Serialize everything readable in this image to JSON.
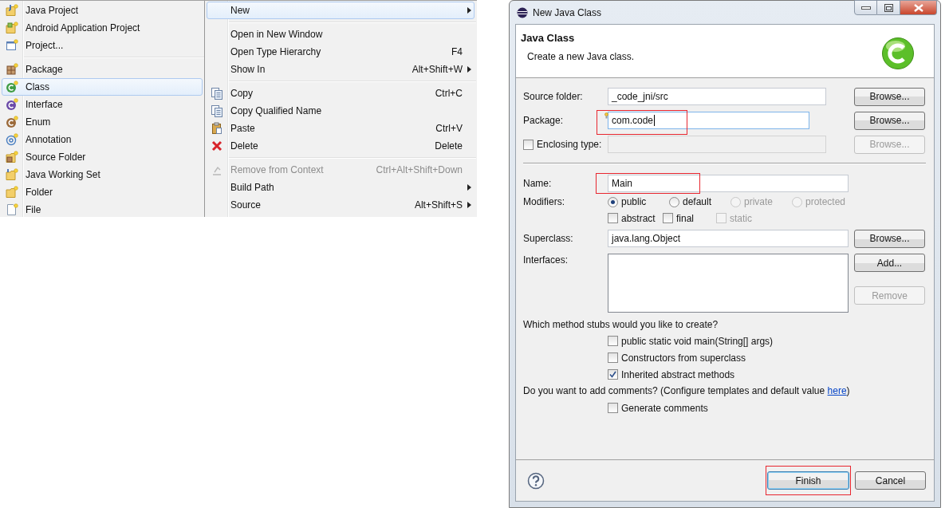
{
  "new_submenu": {
    "groups": [
      [
        {
          "label": "Java Project",
          "kind": "java-project",
          "selected": false
        },
        {
          "label": "Android Application Project",
          "kind": "android-project",
          "selected": false
        },
        {
          "label": "Project...",
          "kind": "project",
          "selected": false
        }
      ],
      [
        {
          "label": "Package",
          "kind": "package",
          "selected": false
        },
        {
          "label": "Class",
          "kind": "class",
          "selected": true
        },
        {
          "label": "Interface",
          "kind": "interface",
          "selected": false
        },
        {
          "label": "Enum",
          "kind": "enum",
          "selected": false
        },
        {
          "label": "Annotation",
          "kind": "annotation",
          "selected": false
        },
        {
          "label": "Source Folder",
          "kind": "source-folder",
          "selected": false
        },
        {
          "label": "Java Working Set",
          "kind": "working-set",
          "selected": false
        },
        {
          "label": "Folder",
          "kind": "folder",
          "selected": false
        },
        {
          "label": "File",
          "kind": "file",
          "selected": false
        }
      ]
    ]
  },
  "context_menu": {
    "groups": [
      [
        {
          "label": "New",
          "submenu": true,
          "selected": true,
          "disabled": false
        }
      ],
      [
        {
          "label": "Open in New Window",
          "submenu": false,
          "selected": false,
          "disabled": false
        },
        {
          "label": "Open Type Hierarchy",
          "shortcut": "F4",
          "submenu": false,
          "selected": false,
          "disabled": false
        },
        {
          "label": "Show In",
          "shortcut": "Alt+Shift+W",
          "submenu": true,
          "selected": false,
          "disabled": false
        }
      ],
      [
        {
          "label": "Copy",
          "kind": "copy",
          "shortcut": "Ctrl+C",
          "submenu": false,
          "selected": false,
          "disabled": false
        },
        {
          "label": "Copy Qualified Name",
          "kind": "copy-name",
          "submenu": false,
          "selected": false,
          "disabled": false
        },
        {
          "label": "Paste",
          "kind": "paste",
          "shortcut": "Ctrl+V",
          "submenu": false,
          "selected": false,
          "disabled": false
        },
        {
          "label": "Delete",
          "kind": "delete",
          "shortcut": "Delete",
          "submenu": false,
          "selected": false,
          "disabled": false
        }
      ],
      [
        {
          "label": "Remove from Context",
          "kind": "remove",
          "shortcut": "Ctrl+Alt+Shift+Down",
          "submenu": false,
          "selected": false,
          "disabled": true
        },
        {
          "label": "Build Path",
          "submenu": true,
          "selected": false,
          "disabled": false
        },
        {
          "label": "Source",
          "shortcut": "Alt+Shift+S",
          "submenu": true,
          "selected": false,
          "disabled": false
        }
      ]
    ]
  },
  "dialog": {
    "title": "New Java Class",
    "header": {
      "title": "Java Class",
      "description": "Create a new Java class."
    },
    "source_folder": {
      "label": "Source folder:",
      "value": "_code_jni/src",
      "button": {
        "label": "Browse...",
        "disabled": false
      }
    },
    "package": {
      "label": "Package:",
      "value": "com.code",
      "focused": true,
      "highlighted": true,
      "button": {
        "label": "Browse...",
        "disabled": false
      }
    },
    "enclosing_type": {
      "label": "Enclosing type:",
      "checked": false,
      "button": {
        "label": "Browse...",
        "disabled": true
      }
    },
    "name": {
      "label": "Name:",
      "value": "Main",
      "highlighted": true
    },
    "modifiers": {
      "label": "Modifiers:",
      "access": [
        {
          "label": "public",
          "selected": true,
          "disabled": false
        },
        {
          "label": "default",
          "selected": false,
          "disabled": false
        },
        {
          "label": "private",
          "selected": false,
          "disabled": true
        },
        {
          "label": "protected",
          "selected": false,
          "disabled": true
        }
      ],
      "flags": [
        {
          "label": "abstract",
          "checked": false,
          "disabled": false
        },
        {
          "label": "final",
          "checked": false,
          "disabled": false
        },
        {
          "label": "static",
          "checked": false,
          "disabled": true
        }
      ]
    },
    "superclass": {
      "label": "Superclass:",
      "value": "java.lang.Object",
      "button": {
        "label": "Browse...",
        "disabled": false
      }
    },
    "interfaces": {
      "label": "Interfaces:",
      "buttons": [
        {
          "label": "Add...",
          "disabled": false
        },
        {
          "label": "Remove",
          "disabled": true
        }
      ]
    },
    "method_stubs": {
      "question": "Which method stubs would you like to create?",
      "options": [
        {
          "label": "public static void main(String[] args)",
          "checked": false
        },
        {
          "label": "Constructors from superclass",
          "checked": false
        },
        {
          "label": "Inherited abstract methods",
          "checked": true
        }
      ]
    },
    "comments": {
      "question": "Do you want to add comments? (Configure templates and default value ",
      "link": "here",
      "closing": ")",
      "options": [
        {
          "label": "Generate comments",
          "checked": false
        }
      ]
    },
    "buttons": [
      {
        "label": "Finish",
        "default": true,
        "highlighted": true
      },
      {
        "label": "Cancel",
        "default": false,
        "highlighted": false
      }
    ]
  }
}
